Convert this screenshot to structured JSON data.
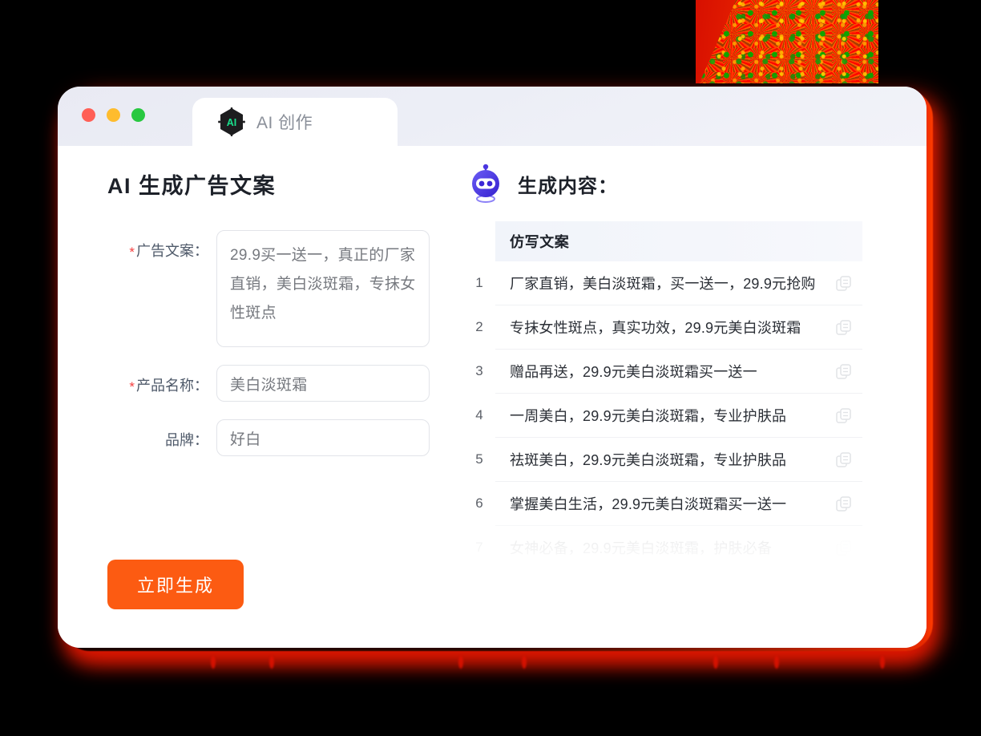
{
  "window": {
    "traffic_lights": [
      {
        "name": "close",
        "color": "#ff5f56"
      },
      {
        "name": "minimize",
        "color": "#febc2e"
      },
      {
        "name": "maximize",
        "color": "#28c840"
      }
    ],
    "tab": {
      "label": "AI 创作",
      "icon": "ai-hexagon-icon",
      "icon_text": "AI"
    }
  },
  "left": {
    "title": "AI 生成广告文案",
    "fields": [
      {
        "name": "ad-copy",
        "label": "广告文案：",
        "required": true,
        "type": "textarea",
        "value": "29.9买一送一，真正的厂家直销，美白淡斑霜，专抹女性斑点"
      },
      {
        "name": "product-name",
        "label": "产品名称：",
        "required": true,
        "type": "input",
        "value": "美白淡斑霜"
      },
      {
        "name": "brand",
        "label": "品牌：",
        "required": false,
        "type": "input",
        "value": "好白"
      }
    ],
    "submit_label": "立即生成",
    "accent_color": "#fc5b12"
  },
  "right": {
    "heading": "生成内容：",
    "robot_icon": "robot-head-icon",
    "table": {
      "column_header": "仿写文案",
      "rows": [
        {
          "index": "1",
          "text": "厂家直销，美白淡斑霜，买一送一，29.9元抢购"
        },
        {
          "index": "2",
          "text": "专抹女性斑点，真实功效，29.9元美白淡斑霜"
        },
        {
          "index": "3",
          "text": "赠品再送，29.9元美白淡斑霜买一送一"
        },
        {
          "index": "4",
          "text": "一周美白，29.9元美白淡斑霜，专业护肤品"
        },
        {
          "index": "5",
          "text": "祛斑美白，29.9元美白淡斑霜，专业护肤品"
        },
        {
          "index": "6",
          "text": "掌握美白生活，29.9元美白淡斑霜买一送一"
        },
        {
          "index": "7",
          "text": "女神必备，29.9元美白淡斑霜，护肤必备"
        }
      ],
      "row_action_icon": "copy-icon"
    }
  }
}
